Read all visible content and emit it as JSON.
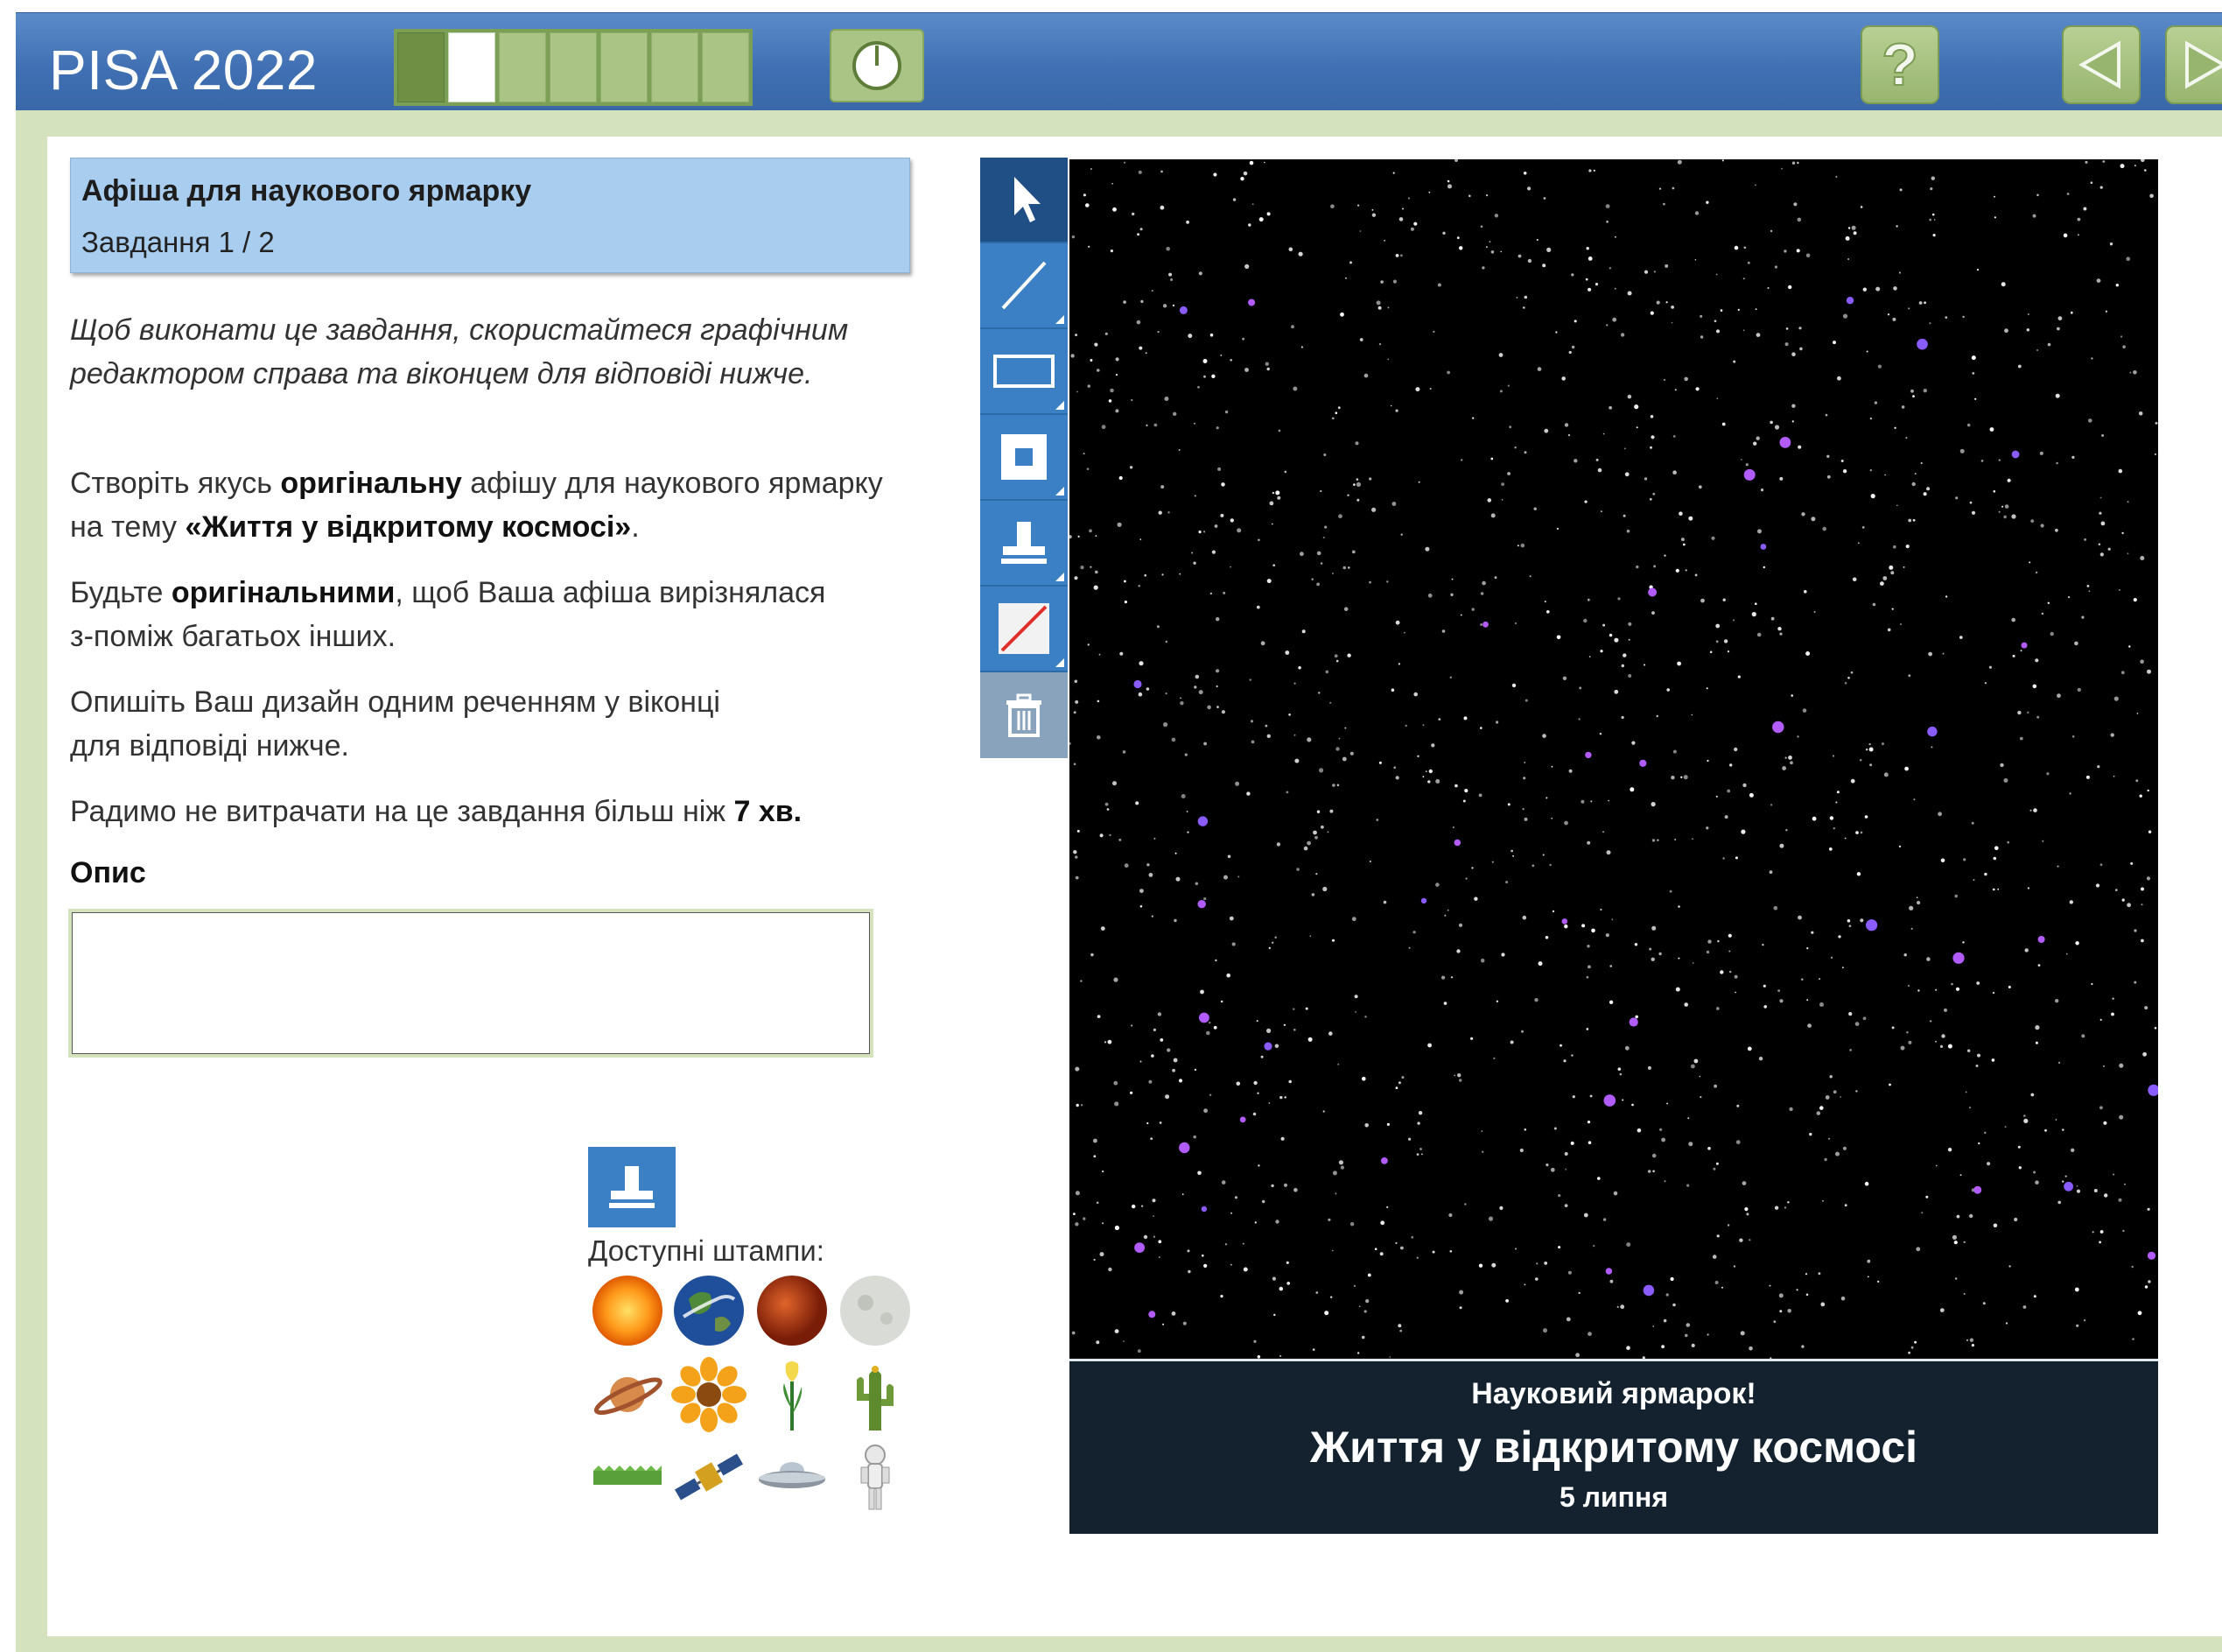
{
  "header": {
    "app_title": "PISA 2022",
    "progress": {
      "total_units": 7,
      "completed": 1,
      "current": 2
    },
    "icons": {
      "timer": "clock-icon",
      "help": "question-mark-icon",
      "back": "triangle-left-icon",
      "next": "triangle-right-icon"
    }
  },
  "task": {
    "title": "Афіша для наукового ярмарку",
    "number": "Завдання 1 / 2",
    "instruction_line1": "Щоб виконати це завдання, скористайтеся графічним",
    "instruction_line2": "редактором справа та віконцем для відповіді нижче.",
    "p1_l1_a": "Створіть якусь ",
    "p1_l1_b": "оригінальну",
    "p1_l1_c": " афішу для наукового ярмарку",
    "p1_l2_a": "на тему ",
    "p1_l2_b": "«Життя у відкритому космосі»",
    "p1_l2_c": ".",
    "p2_l1_a": "Будьте ",
    "p2_l1_b": "оригінальними",
    "p2_l1_c": ", щоб Ваша афіша вирізнялася",
    "p2_l2": "з-поміж багатьох інших.",
    "p3_l1": "Опишіть Ваш дизайн одним реченням у віконці",
    "p3_l2": "для відповіді нижче.",
    "p4_a": "Радимо не витрачати на це завдання більш ніж ",
    "p4_b": "7 хв.",
    "description_label": "Опис",
    "description_value": ""
  },
  "stamps": {
    "label": "Доступні штампи:",
    "items": [
      "sun",
      "earth",
      "mars",
      "moon",
      "saturn",
      "sunflower",
      "tulip",
      "cactus",
      "grass",
      "satellite",
      "ufo",
      "astronaut"
    ]
  },
  "toolbar": {
    "tools": [
      "select-arrow-icon",
      "line-icon",
      "rectangle-outline-icon",
      "filled-square-icon",
      "stamp-icon",
      "eraser-icon",
      "trash-icon"
    ],
    "selected": "select-arrow-icon"
  },
  "poster": {
    "background": "#000000",
    "banner_line1": "Науковий ярмарок!",
    "banner_line2": "Життя у відкритому космосі",
    "banner_line3": "5 липня"
  },
  "colors": {
    "header_blue": "#4a7bbd",
    "frame_green": "#d4e3bd",
    "title_box_blue": "#a9cdef",
    "tool_blue": "#3b7fc4",
    "banner_navy": "#142230"
  }
}
